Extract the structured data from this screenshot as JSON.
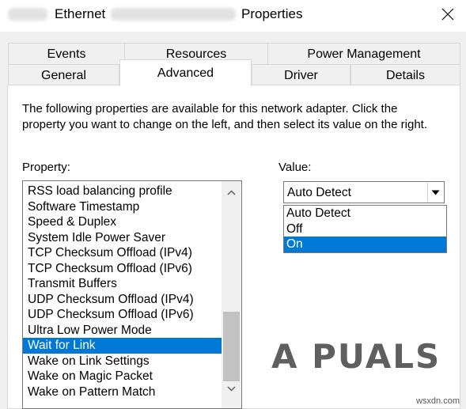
{
  "window": {
    "title_part_1": "Ethernet",
    "title_part_2": "Properties",
    "close_label": "✕"
  },
  "tabs": {
    "row_back": [
      "Events",
      "Resources",
      "Power Management"
    ],
    "row_front": [
      "General",
      "Advanced",
      "Driver",
      "Details"
    ],
    "active": "Advanced"
  },
  "advanced": {
    "description": "The following properties are available for this network adapter. Click the property you want to change on the left, and then select its value on the right.",
    "property_label": "Property:",
    "value_label": "Value:",
    "properties": [
      "RSS load balancing profile",
      "Software Timestamp",
      "Speed & Duplex",
      "System Idle Power Saver",
      "TCP Checksum Offload (IPv4)",
      "TCP Checksum Offload (IPv6)",
      "Transmit Buffers",
      "UDP Checksum Offload (IPv4)",
      "UDP Checksum Offload (IPv6)",
      "Ultra Low Power Mode",
      "Wait for Link",
      "Wake on Link Settings",
      "Wake on Magic Packet",
      "Wake on Pattern Match"
    ],
    "selected_property": "Wait for Link",
    "value_current": "Auto Detect",
    "value_options": [
      "Auto Detect",
      "Off",
      "On"
    ],
    "value_highlighted": "On"
  },
  "watermark": {
    "brand": "A PUALS",
    "site": "wsxdn.com"
  },
  "colors": {
    "selection": "#0078d7",
    "dialog_bg": "#f0f0f0"
  }
}
